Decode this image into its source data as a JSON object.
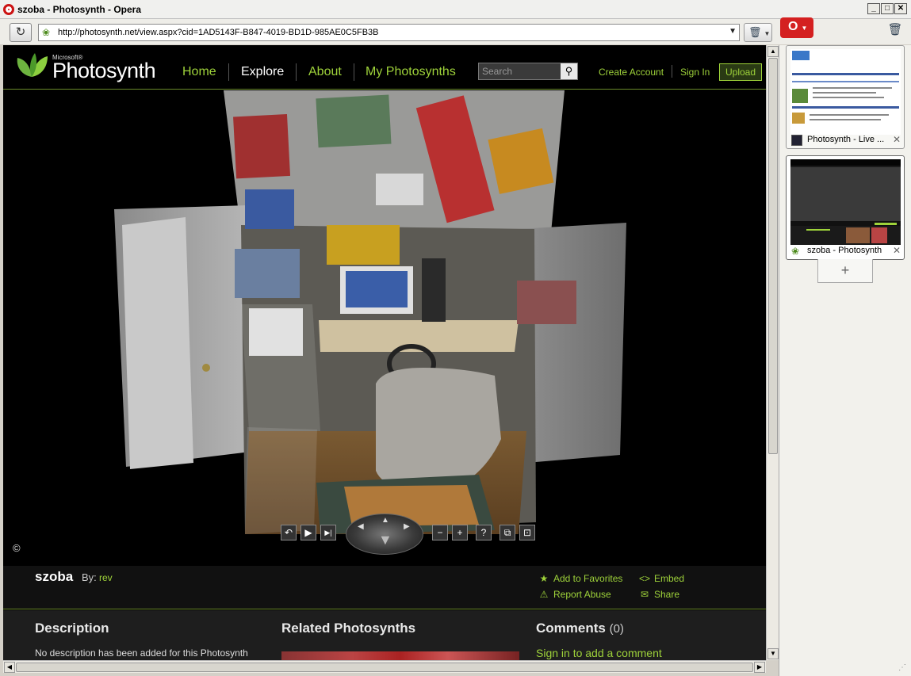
{
  "window": {
    "title": "szoba - Photosynth - Opera",
    "buttons": {
      "minimize": "_",
      "maximize": "□",
      "close": "✕"
    }
  },
  "addressbar": {
    "url": "http://photosynth.net/view.aspx?cid=1AD5143F-B847-4019-BD1D-985AE0C5FB3B",
    "reload_icon": "↻",
    "dropdown": "▼"
  },
  "site": {
    "logo": {
      "brand_small": "Microsoft®",
      "brand_name": "Photosynth"
    },
    "nav": [
      {
        "label": "Home"
      },
      {
        "label": "Explore"
      },
      {
        "label": "About"
      },
      {
        "label": "My Photosynths"
      }
    ],
    "search": {
      "placeholder": "Search",
      "button_icon": "⚲"
    },
    "links": {
      "create_account": "Create Account",
      "sign_in": "Sign In",
      "upload": "Upload"
    }
  },
  "viewer": {
    "copyright": "©",
    "controls": {
      "undo": "↶",
      "play": "▶",
      "next": "▶|",
      "zoom_out": "−",
      "zoom_in": "+",
      "help": "?",
      "view2d": "⧉",
      "fullscreen": "⊡"
    }
  },
  "synth": {
    "title": "szoba",
    "by_label": "By:",
    "author": "rev",
    "actions": {
      "favorites": "Add to Favorites",
      "embed": "Embed",
      "report": "Report Abuse",
      "share": "Share"
    }
  },
  "sections": {
    "description": {
      "heading": "Description",
      "text": "No description has been added for this Photosynth"
    },
    "related": {
      "heading": "Related Photosynths"
    },
    "comments": {
      "heading": "Comments",
      "count": "(0)",
      "signin": "Sign in to add a comment"
    }
  },
  "tabs_panel": {
    "tabs": [
      {
        "label": "Photosynth - Live ..."
      },
      {
        "label": "szoba - Photosynth"
      }
    ],
    "new_tab": "+"
  },
  "colors": {
    "accent_green": "#9ed23a",
    "page_bg": "#000000",
    "chrome": "#d4d0c8",
    "opera_red": "#d42020"
  }
}
